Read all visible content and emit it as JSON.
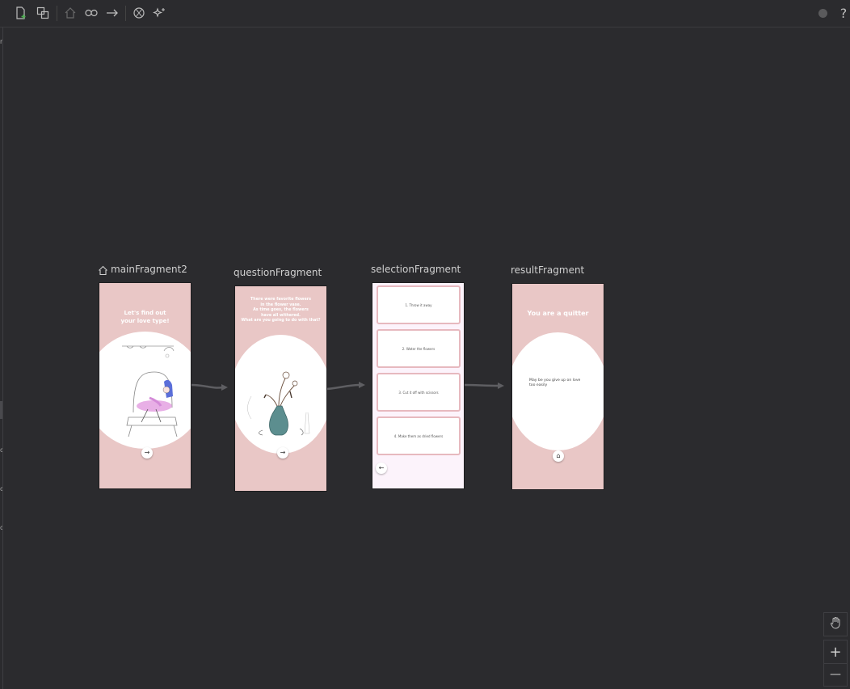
{
  "toolbar": {
    "icons": [
      "new-destination-icon",
      "nested-graph-icon",
      "home-icon",
      "link-icon",
      "action-arrow-icon",
      "auto-arrange-icon",
      "magic-icon"
    ],
    "status_icon": "status-dot-icon",
    "help_label": "?"
  },
  "graph": {
    "start_destination": "mainFragment2",
    "fragments": [
      {
        "name": "mainFragment2",
        "title_text": "Let's find out\nyour love type!"
      },
      {
        "name": "questionFragment",
        "title_text": "There were favorite flowers\nin the flower vase.\nAs time goes, the flowers\nhave all withered.\nWhat are you going to do with that?"
      },
      {
        "name": "selectionFragment",
        "choices": [
          "1. Throw it away",
          "2. Water the flowers",
          "3. Cut it off with scissors",
          "4. Make them as dried flowers"
        ],
        "back_label": "←"
      },
      {
        "name": "resultFragment",
        "title_text": "You are a quitter",
        "body_text": "May be you give up on love\ntoo easily"
      }
    ],
    "next_label": "→",
    "home_label": "⌂"
  },
  "zoom_controls": {
    "pan_icon": "hand-icon",
    "zoom_in_label": "+",
    "zoom_out_label": "—"
  },
  "colors": {
    "canvas": "#2b2b2e",
    "screen_pink": "#e9c7c6",
    "selection_bg": "#fcf3fb",
    "choice_border": "#e7b9bf",
    "edge": "#5e5e62",
    "add_accent": "#4caf50"
  }
}
